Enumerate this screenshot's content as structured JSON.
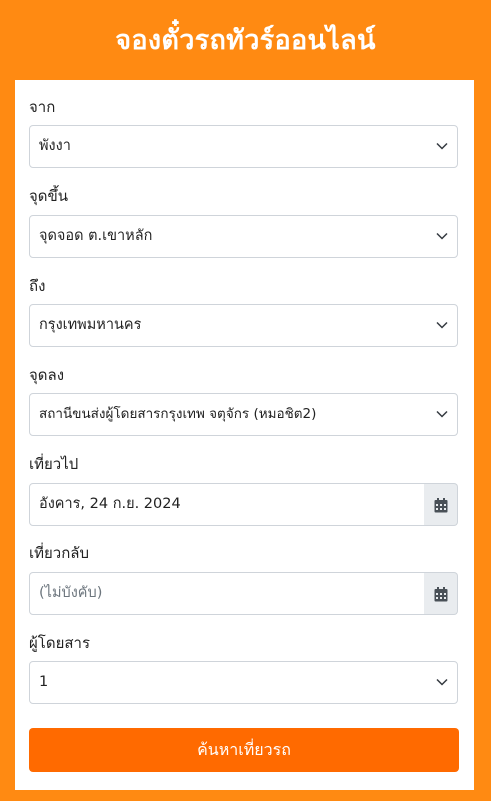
{
  "header": {
    "title": "จองตั๋วรถทัวร์ออนไลน์"
  },
  "form": {
    "from": {
      "label": "จาก",
      "value": "พังงา"
    },
    "pickup": {
      "label": "จุดขึ้น",
      "value": "จุดจอด ต.เขาหลัก"
    },
    "to": {
      "label": "ถึง",
      "value": "กรุงเทพมหานคร"
    },
    "dropoff": {
      "label": "จุดลง",
      "value": "สถานีขนส่งผู้โดยสารกรุงเทพ จตุจักร (หมอชิต2)"
    },
    "depart": {
      "label": "เที่ยวไป",
      "value": "อังคาร, 24 ก.ย. 2024"
    },
    "return": {
      "label": "เที่ยวกลับ",
      "placeholder": "(ไม่บังคับ)"
    },
    "passengers": {
      "label": "ผู้โดยสาร",
      "value": "1"
    },
    "submit_label": "ค้นหาเที่ยวรถ"
  },
  "icons": [
    "chevron-down-icon",
    "calendar-icon"
  ],
  "colors": {
    "background": "#ff8a12",
    "button": "#ff6a00"
  }
}
